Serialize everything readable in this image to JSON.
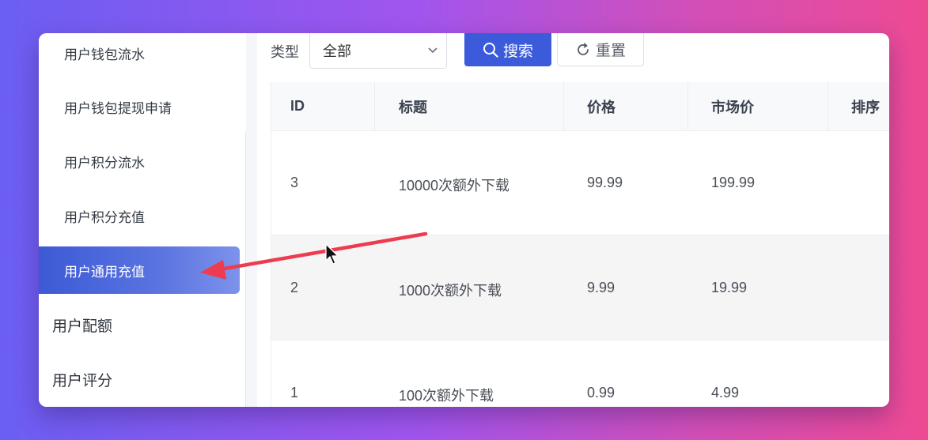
{
  "sidebar": {
    "items": [
      {
        "label": "用户钱包流水",
        "level": "sub",
        "active": false
      },
      {
        "label": "用户钱包提现申请",
        "level": "sub",
        "active": false
      },
      {
        "label": "用户积分流水",
        "level": "sub",
        "active": false
      },
      {
        "label": "用户积分充值",
        "level": "sub",
        "active": false
      },
      {
        "label": "用户通用充值",
        "level": "sub",
        "active": true
      },
      {
        "label": "用户配额",
        "level": "top",
        "active": false
      },
      {
        "label": "用户评分",
        "level": "top",
        "active": false
      }
    ]
  },
  "filter": {
    "type_label": "类型",
    "type_selected": "全部",
    "search_label": "搜索",
    "reset_label": "重置"
  },
  "table": {
    "columns": [
      "ID",
      "标题",
      "价格",
      "市场价",
      "排序"
    ],
    "rows": [
      {
        "id": "3",
        "title": "10000次额外下载",
        "price": "99.99",
        "market_price": "199.99",
        "sort": ""
      },
      {
        "id": "2",
        "title": "1000次额外下载",
        "price": "9.99",
        "market_price": "19.99",
        "sort": ""
      },
      {
        "id": "1",
        "title": "100次额外下载",
        "price": "0.99",
        "market_price": "4.99",
        "sort": ""
      }
    ]
  },
  "colors": {
    "accent": "#3b5bdb",
    "active_item": "#4a66db",
    "annotation_arrow": "#ee3b4f"
  },
  "icons": [
    "search-icon",
    "refresh-icon",
    "chevron-down-icon",
    "mouse-cursor-icon",
    "annotation-arrow"
  ]
}
